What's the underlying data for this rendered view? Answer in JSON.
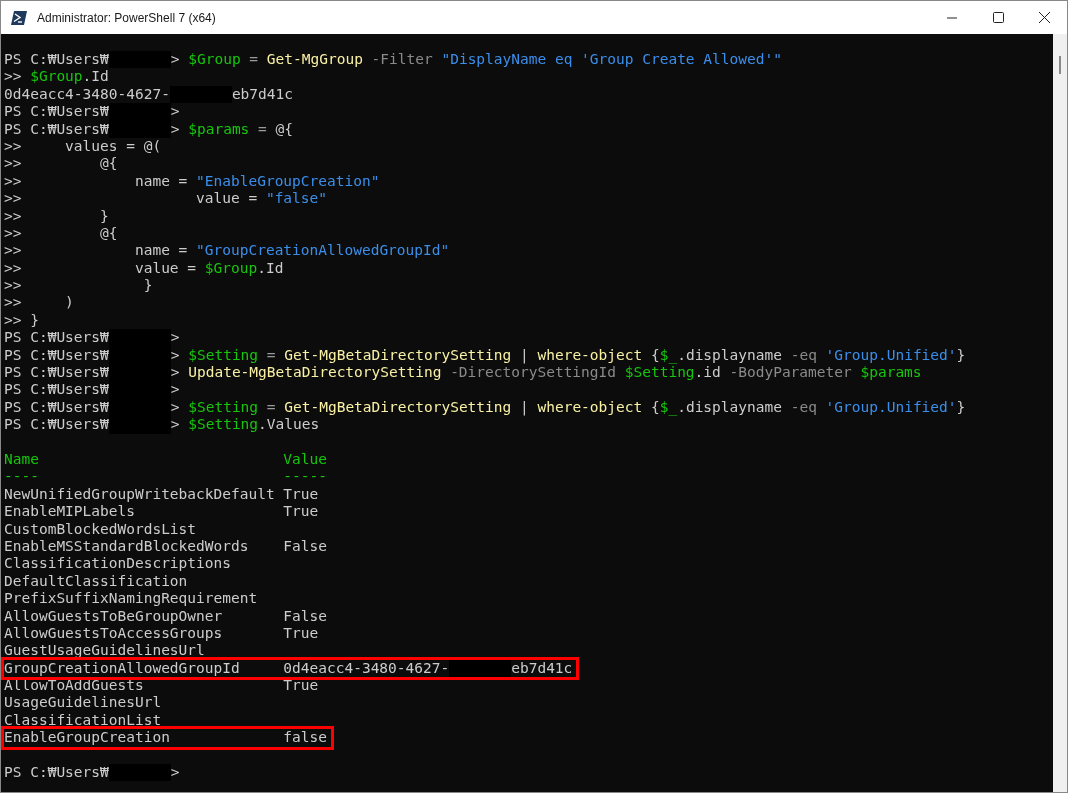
{
  "window": {
    "title": "Administrator: PowerShell 7 (x64)"
  },
  "console": {
    "lines": [
      [
        {
          "kind": "prompt",
          "text": "PS C:₩Users₩"
        },
        {
          "kind": "redacted"
        },
        {
          "kind": "plain",
          "text": "> "
        },
        {
          "kind": "variable",
          "text": "$Group"
        },
        {
          "kind": "operator",
          "text": " = "
        },
        {
          "kind": "command",
          "text": "Get-MgGroup "
        },
        {
          "kind": "parameter",
          "text": "-Filter "
        },
        {
          "kind": "string",
          "text": "\"DisplayName eq 'Group Create Allowed'\""
        }
      ],
      [
        {
          "kind": "plain",
          "text": ">> "
        },
        {
          "kind": "variable",
          "text": "$Group"
        },
        {
          "kind": "plain",
          "text": ".Id"
        }
      ],
      [
        {
          "kind": "plain",
          "text": "0d4eacc4-3480-4627-"
        },
        {
          "kind": "redacted"
        },
        {
          "kind": "plain",
          "text": "eb7d41c"
        }
      ],
      [
        {
          "kind": "prompt",
          "text": "PS C:₩Users₩"
        },
        {
          "kind": "redacted"
        },
        {
          "kind": "plain",
          "text": ">"
        }
      ],
      [
        {
          "kind": "prompt",
          "text": "PS C:₩Users₩"
        },
        {
          "kind": "redacted"
        },
        {
          "kind": "plain",
          "text": "> "
        },
        {
          "kind": "variable",
          "text": "$params"
        },
        {
          "kind": "operator",
          "text": " = "
        },
        {
          "kind": "plain",
          "text": "@{"
        }
      ],
      [
        {
          "kind": "plain",
          "text": ">>     values = @("
        }
      ],
      [
        {
          "kind": "plain",
          "text": ">>         @{"
        }
      ],
      [
        {
          "kind": "plain",
          "text": ">>             name = "
        },
        {
          "kind": "string",
          "text": "\"EnableGroupCreation\""
        }
      ],
      [
        {
          "kind": "plain",
          "text": ">>                    value = "
        },
        {
          "kind": "string",
          "text": "\"false\""
        }
      ],
      [
        {
          "kind": "plain",
          "text": ">>         }"
        }
      ],
      [
        {
          "kind": "plain",
          "text": ">>         @{"
        }
      ],
      [
        {
          "kind": "plain",
          "text": ">>             name = "
        },
        {
          "kind": "string",
          "text": "\"GroupCreationAllowedGroupId\""
        }
      ],
      [
        {
          "kind": "plain",
          "text": ">>             value = "
        },
        {
          "kind": "variable",
          "text": "$Group"
        },
        {
          "kind": "plain",
          "text": ".Id"
        }
      ],
      [
        {
          "kind": "plain",
          "text": ">>              }"
        }
      ],
      [
        {
          "kind": "plain",
          "text": ">>     )"
        }
      ],
      [
        {
          "kind": "plain",
          "text": ">> }"
        }
      ],
      [
        {
          "kind": "prompt",
          "text": "PS C:₩Users₩"
        },
        {
          "kind": "redacted"
        },
        {
          "kind": "plain",
          "text": ">"
        }
      ],
      [
        {
          "kind": "prompt",
          "text": "PS C:₩Users₩"
        },
        {
          "kind": "redacted"
        },
        {
          "kind": "plain",
          "text": "> "
        },
        {
          "kind": "variable",
          "text": "$Setting"
        },
        {
          "kind": "operator",
          "text": " = "
        },
        {
          "kind": "command",
          "text": "Get-MgBetaDirectorySetting"
        },
        {
          "kind": "plain",
          "text": " | "
        },
        {
          "kind": "command",
          "text": "where-object"
        },
        {
          "kind": "plain",
          "text": " {"
        },
        {
          "kind": "variable",
          "text": "$_"
        },
        {
          "kind": "plain",
          "text": ".displayname "
        },
        {
          "kind": "parameter",
          "text": "-eq "
        },
        {
          "kind": "string",
          "text": "'Group.Unified'"
        },
        {
          "kind": "plain",
          "text": "}"
        }
      ],
      [
        {
          "kind": "prompt",
          "text": "PS C:₩Users₩"
        },
        {
          "kind": "redacted"
        },
        {
          "kind": "plain",
          "text": "> "
        },
        {
          "kind": "command",
          "text": "Update-MgBetaDirectorySetting "
        },
        {
          "kind": "parameter",
          "text": "-DirectorySettingId "
        },
        {
          "kind": "variable",
          "text": "$Setting"
        },
        {
          "kind": "plain",
          "text": ".id "
        },
        {
          "kind": "parameter",
          "text": "-BodyParameter "
        },
        {
          "kind": "variable",
          "text": "$params"
        }
      ],
      [
        {
          "kind": "prompt",
          "text": "PS C:₩Users₩"
        },
        {
          "kind": "redacted"
        },
        {
          "kind": "plain",
          "text": ">"
        }
      ],
      [
        {
          "kind": "prompt",
          "text": "PS C:₩Users₩"
        },
        {
          "kind": "redacted"
        },
        {
          "kind": "plain",
          "text": "> "
        },
        {
          "kind": "variable",
          "text": "$Setting"
        },
        {
          "kind": "operator",
          "text": " = "
        },
        {
          "kind": "command",
          "text": "Get-MgBetaDirectorySetting"
        },
        {
          "kind": "plain",
          "text": " | "
        },
        {
          "kind": "command",
          "text": "where-object"
        },
        {
          "kind": "plain",
          "text": " {"
        },
        {
          "kind": "variable",
          "text": "$_"
        },
        {
          "kind": "plain",
          "text": ".displayname "
        },
        {
          "kind": "parameter",
          "text": "-eq "
        },
        {
          "kind": "string",
          "text": "'Group.Unified'"
        },
        {
          "kind": "plain",
          "text": "}"
        }
      ],
      [
        {
          "kind": "prompt",
          "text": "PS C:₩Users₩"
        },
        {
          "kind": "redacted"
        },
        {
          "kind": "plain",
          "text": "> "
        },
        {
          "kind": "variable",
          "text": "$Setting"
        },
        {
          "kind": "plain",
          "text": ".Values"
        }
      ]
    ],
    "output": {
      "headers": [
        "Name",
        "Value"
      ],
      "underlines": [
        "----",
        "-----"
      ],
      "rows": [
        {
          "name": "NewUnifiedGroupWritebackDefault",
          "value": [
            {
              "kind": "plain",
              "text": "True"
            }
          ],
          "highlighted": false
        },
        {
          "name": "EnableMIPLabels",
          "value": [
            {
              "kind": "plain",
              "text": "True"
            }
          ],
          "highlighted": false
        },
        {
          "name": "CustomBlockedWordsList",
          "value": [],
          "highlighted": false
        },
        {
          "name": "EnableMSStandardBlockedWords",
          "value": [
            {
              "kind": "plain",
              "text": "False"
            }
          ],
          "highlighted": false
        },
        {
          "name": "ClassificationDescriptions",
          "value": [],
          "highlighted": false
        },
        {
          "name": "DefaultClassification",
          "value": [],
          "highlighted": false
        },
        {
          "name": "PrefixSuffixNamingRequirement",
          "value": [],
          "highlighted": false
        },
        {
          "name": "AllowGuestsToBeGroupOwner",
          "value": [
            {
              "kind": "plain",
              "text": "False"
            }
          ],
          "highlighted": false
        },
        {
          "name": "AllowGuestsToAccessGroups",
          "value": [
            {
              "kind": "plain",
              "text": "True"
            }
          ],
          "highlighted": false
        },
        {
          "name": "GuestUsageGuidelinesUrl",
          "value": [],
          "highlighted": false
        },
        {
          "name": "GroupCreationAllowedGroupId",
          "value": [
            {
              "kind": "plain",
              "text": "0d4eacc4-3480-4627-"
            },
            {
              "kind": "redacted"
            },
            {
              "kind": "plain",
              "text": "eb7d41c"
            }
          ],
          "highlighted": true
        },
        {
          "name": "AllowToAddGuests",
          "value": [
            {
              "kind": "plain",
              "text": "True"
            }
          ],
          "highlighted": false
        },
        {
          "name": "UsageGuidelinesUrl",
          "value": [],
          "highlighted": false
        },
        {
          "name": "ClassificationList",
          "value": [],
          "highlighted": false
        },
        {
          "name": "EnableGroupCreation",
          "value": [
            {
              "kind": "plain",
              "text": "false"
            }
          ],
          "highlighted": true
        }
      ]
    },
    "final_prompt": [
      {
        "kind": "prompt",
        "text": "PS C:₩Users₩"
      },
      {
        "kind": "redacted"
      },
      {
        "kind": "plain",
        "text": ">"
      }
    ]
  }
}
